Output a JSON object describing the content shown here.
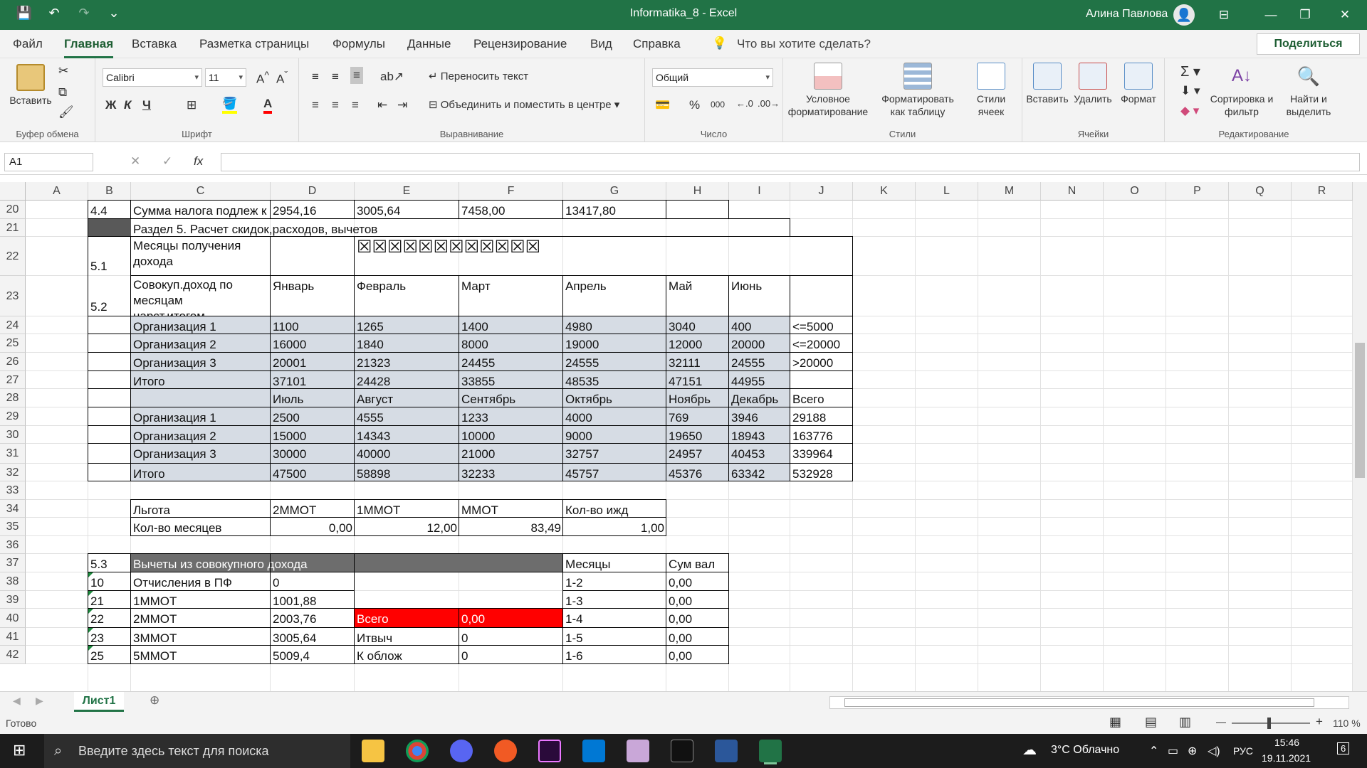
{
  "window": {
    "title": "Informatika_8  -  Excel",
    "user": "Алина Павлова",
    "minimize": "—",
    "restore": "❐",
    "close": "✕",
    "ribbon_display": "⊟"
  },
  "qat": {
    "save": "💾",
    "undo": "↶",
    "redo": "↷",
    "customize": "⌄"
  },
  "menu": {
    "tabs": [
      "Файл",
      "Главная",
      "Вставка",
      "Разметка страницы",
      "Формулы",
      "Данные",
      "Рецензирование",
      "Вид",
      "Справка"
    ],
    "active": "Главная",
    "help_placeholder": "Что вы хотите сделать?",
    "share": "Поделиться"
  },
  "ribbon": {
    "clipboard": {
      "paste": "Вставить",
      "label": "Буфер обмена"
    },
    "font": {
      "name": "Calibri",
      "size": "11",
      "bold": "Ж",
      "italic": "К",
      "underline": "Ч",
      "label": "Шрифт"
    },
    "alignment": {
      "wrap": "Переносить текст",
      "merge": "Объединить и поместить в центре",
      "label": "Выравнивание"
    },
    "number": {
      "format": "Общий",
      "percent": "%",
      "thousands": "000",
      "label": "Число"
    },
    "styles": {
      "conditional": "Условное форматирование",
      "as_table": "Форматировать как таблицу",
      "cell_styles": "Стили ячеек",
      "label": "Стили"
    },
    "cells": {
      "insert": "Вставить",
      "delete": "Удалить",
      "format": "Формат",
      "label": "Ячейки"
    },
    "editing": {
      "sort": "Сортировка и фильтр",
      "find": "Найти и выделить",
      "label": "Редактирование"
    }
  },
  "formula_bar": {
    "name_box": "A1",
    "cancel": "✕",
    "enter": "✓",
    "fx": "fx",
    "value": ""
  },
  "columns": [
    "A",
    "B",
    "C",
    "D",
    "E",
    "F",
    "G",
    "H",
    "I",
    "J",
    "K",
    "L",
    "M",
    "N",
    "O",
    "P",
    "Q",
    "R"
  ],
  "rows": [
    "20",
    "21",
    "22",
    "23",
    "24",
    "25",
    "26",
    "27",
    "28",
    "29",
    "30",
    "31",
    "32",
    "33",
    "34",
    "35",
    "36",
    "37",
    "38",
    "39",
    "40",
    "41",
    "42"
  ],
  "cells": {
    "r20": [
      "4.4",
      "Сумма налога подлеж к возврату",
      "2954,16",
      "3005,64",
      "7458,00",
      "13417,80"
    ],
    "r21": [
      "Раздел 5. Расчет скидок,расходов, вычетов"
    ],
    "r22": [
      "5.1",
      "Месяцы получения\nдохода",
      "☒☒☒☒☒☒☒☒☒☒☒☒"
    ],
    "r23": [
      "5.2",
      "Совокуп.доход по\nмесяцам\nнарст.итогом",
      "Январь",
      "Февраль",
      "Март",
      "Апрель",
      "Май",
      "Июнь"
    ],
    "r24": [
      "Организация 1",
      "1100",
      "1265",
      "1400",
      "4980",
      "3040",
      "400",
      "<=5000"
    ],
    "r25": [
      "Организация 2",
      "16000",
      "1840",
      "8000",
      "19000",
      "12000",
      "20000",
      "<=20000"
    ],
    "r26": [
      "Организация 3",
      "20001",
      "21323",
      "24455",
      "24555",
      "32111",
      "24555",
      ">20000"
    ],
    "r27": [
      "Итого",
      "37101",
      "24428",
      "33855",
      "48535",
      "47151",
      "44955"
    ],
    "r28": [
      "Июль",
      "Август",
      "Сентябрь",
      "Октябрь",
      "Ноябрь",
      "Декабрь",
      "Всего"
    ],
    "r29": [
      "Организация 1",
      "2500",
      "4555",
      "1233",
      "4000",
      "769",
      "3946",
      "29188"
    ],
    "r30": [
      "Организация 2",
      "15000",
      "14343",
      "10000",
      "9000",
      "19650",
      "18943",
      "163776"
    ],
    "r31": [
      "Организация 3",
      "30000",
      "40000",
      "21000",
      "32757",
      "24957",
      "40453",
      "339964"
    ],
    "r32": [
      "Итого",
      "47500",
      "58898",
      "32233",
      "45757",
      "45376",
      "63342",
      "532928"
    ],
    "r34": [
      "Льгота",
      "2ММОТ",
      "1ММОТ",
      "ММОТ",
      "Кол-во ижд"
    ],
    "r35": [
      "Кол-во месяцев",
      "0,00",
      "12,00",
      "83,49",
      "1,00"
    ],
    "r37": [
      "5.3",
      "Вычеты из совокупного дохода",
      "Месяцы",
      "Сум вал"
    ],
    "r38": [
      "10",
      "Отчисления в ПФ",
      "0",
      "1-2",
      "0,00"
    ],
    "r39": [
      "21",
      "1ММОТ",
      "1001,88",
      "1-3",
      "0,00"
    ],
    "r40": [
      "22",
      "2ММОТ",
      "2003,76",
      "Всего",
      "0,00",
      "1-4",
      "0,00"
    ],
    "r41": [
      "23",
      "3ММОТ",
      "3005,64",
      "Итвыч",
      "0",
      "1-5",
      "0,00"
    ],
    "r42": [
      "25",
      "5ММОТ",
      "5009,4",
      "К облож",
      "0",
      "1-6",
      "0,00"
    ]
  },
  "colors": {
    "excel_green": "#217346",
    "row_fill": "#d6dce4",
    "header_fill": "#6d6d6d",
    "red": "#ff0000",
    "dark_fill": "#595959"
  },
  "sheet_tabs": [
    "Лист1"
  ],
  "status": {
    "ready": "Готово",
    "zoom": "110 %"
  },
  "taskbar": {
    "search_placeholder": "Введите здесь текст для поиска",
    "weather": "3°C  Облачно",
    "lang": "РУС",
    "time": "15:46",
    "date": "19.11.2021",
    "notifications": "6"
  }
}
